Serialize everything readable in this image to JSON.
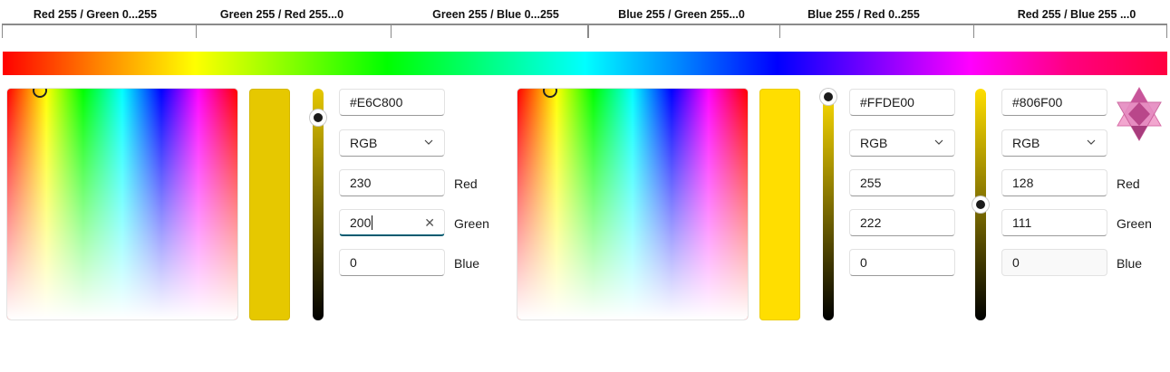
{
  "header": {
    "segments": [
      "Red 255 / Green 0...255",
      "Green 255 / Red 255...0",
      "Green 255 / Blue 0...255",
      "Blue 255 / Green 255...0",
      "Blue 255 / Red 0..255",
      "Red 255 / Blue 255 ...0"
    ]
  },
  "pickers": [
    {
      "color": "#E6C800",
      "hex": "#E6C800",
      "model": "RGB",
      "channels": [
        {
          "label": "Red",
          "value": "230"
        },
        {
          "label": "Green",
          "value": "200"
        },
        {
          "label": "Blue",
          "value": "0"
        }
      ]
    },
    {
      "color": "#FFDE00",
      "hex": "#FFDE00",
      "model": "RGB",
      "channels": [
        {
          "label": "Red",
          "value": "255"
        },
        {
          "label": "Green",
          "value": "222"
        },
        {
          "label": "Blue",
          "value": "0"
        }
      ]
    },
    {
      "color": "#806F00",
      "hex": "#806F00",
      "model": "RGB",
      "channels": [
        {
          "label": "Red",
          "value": "128"
        },
        {
          "label": "Green",
          "value": "111"
        },
        {
          "label": "Blue",
          "value": "0"
        }
      ]
    }
  ],
  "icons": {
    "clear": "clear-icon",
    "dropdown": "chevron-down-icon",
    "logo": "star-tetrahedron-icon"
  },
  "colors": {
    "accent": "#005A70",
    "logo": "#E57FB5"
  }
}
